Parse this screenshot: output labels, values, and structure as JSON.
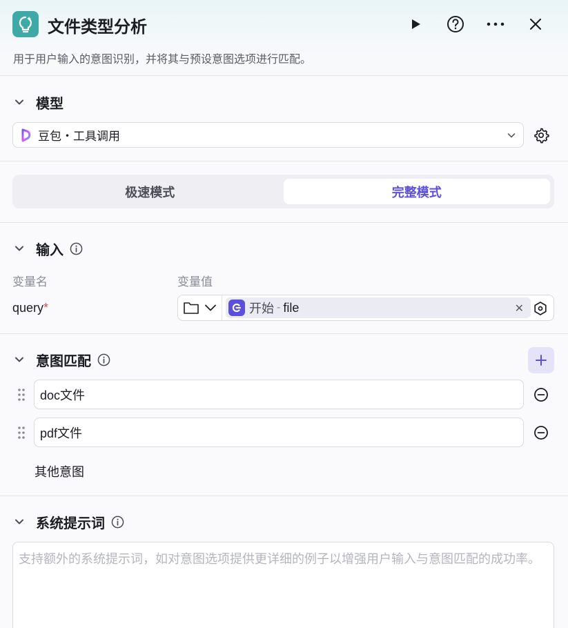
{
  "header": {
    "title": "文件类型分析",
    "description": "用于用户输入的意图识别，并将其与预设意图选项进行匹配。"
  },
  "model_section": {
    "title": "模型",
    "selected_model": "豆包・工具调用"
  },
  "mode": {
    "options": [
      "极速模式",
      "完整模式"
    ],
    "active": "完整模式"
  },
  "input_section": {
    "title": "输入",
    "col_name": "变量名",
    "col_value": "变量值",
    "variable": {
      "name": "query",
      "required_mark": "*",
      "ref_source": "开始",
      "ref_separator": "-",
      "ref_var": "file"
    }
  },
  "intent_section": {
    "title": "意图匹配",
    "intents": [
      "doc文件",
      "pdf文件"
    ],
    "other": "其他意图"
  },
  "prompt_section": {
    "title": "系统提示词",
    "placeholder": "支持额外的系统提示词，如对意图选项提供更详细的例子以增强用户输入与意图匹配的成功率。"
  },
  "colors": {
    "accent": "#5b4fdb",
    "app_icon": "#3ea9a6",
    "required": "#e5484d"
  }
}
